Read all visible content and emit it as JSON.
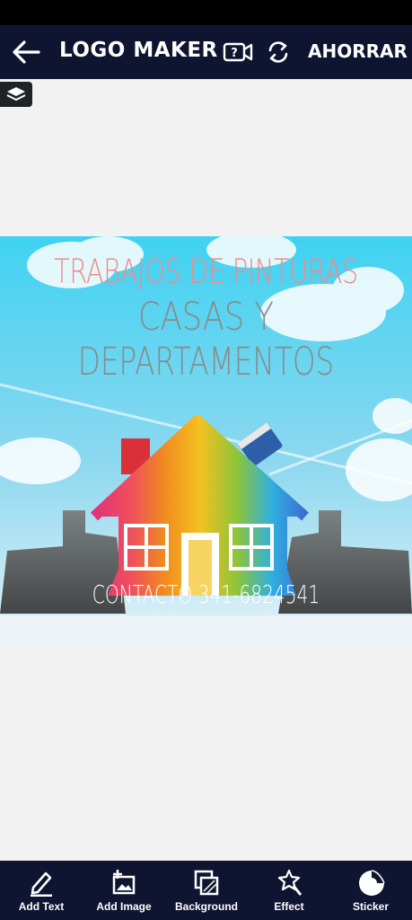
{
  "header": {
    "title": "LOGO MAKER",
    "save_label": "AHORRAR",
    "back_icon": "arrow-left-icon",
    "help_icon": "question-video-icon",
    "refresh_icon": "refresh-icon"
  },
  "layers": {
    "icon": "layers-icon"
  },
  "canvas": {
    "line1": "TRABAJOS DE PINTURAS",
    "line2": "CASAS Y",
    "line3": "DEPARTAMENTOS",
    "contact": "CONTACTO 341-6824541",
    "colors": {
      "line1": "#f08a8a",
      "body_text": "#8a8a8a",
      "sky": "#3fd2f2"
    }
  },
  "toolbar": {
    "items": [
      {
        "label": "Add Text",
        "icon": "pencil-icon"
      },
      {
        "label": "Add Image",
        "icon": "add-image-icon"
      },
      {
        "label": "Background",
        "icon": "background-icon"
      },
      {
        "label": "Effect",
        "icon": "magic-wand-icon"
      },
      {
        "label": "Sticker",
        "icon": "sticker-icon"
      }
    ]
  },
  "theme": {
    "bar_bg": "#0f1530",
    "page_bg": "#f2f2f2"
  }
}
